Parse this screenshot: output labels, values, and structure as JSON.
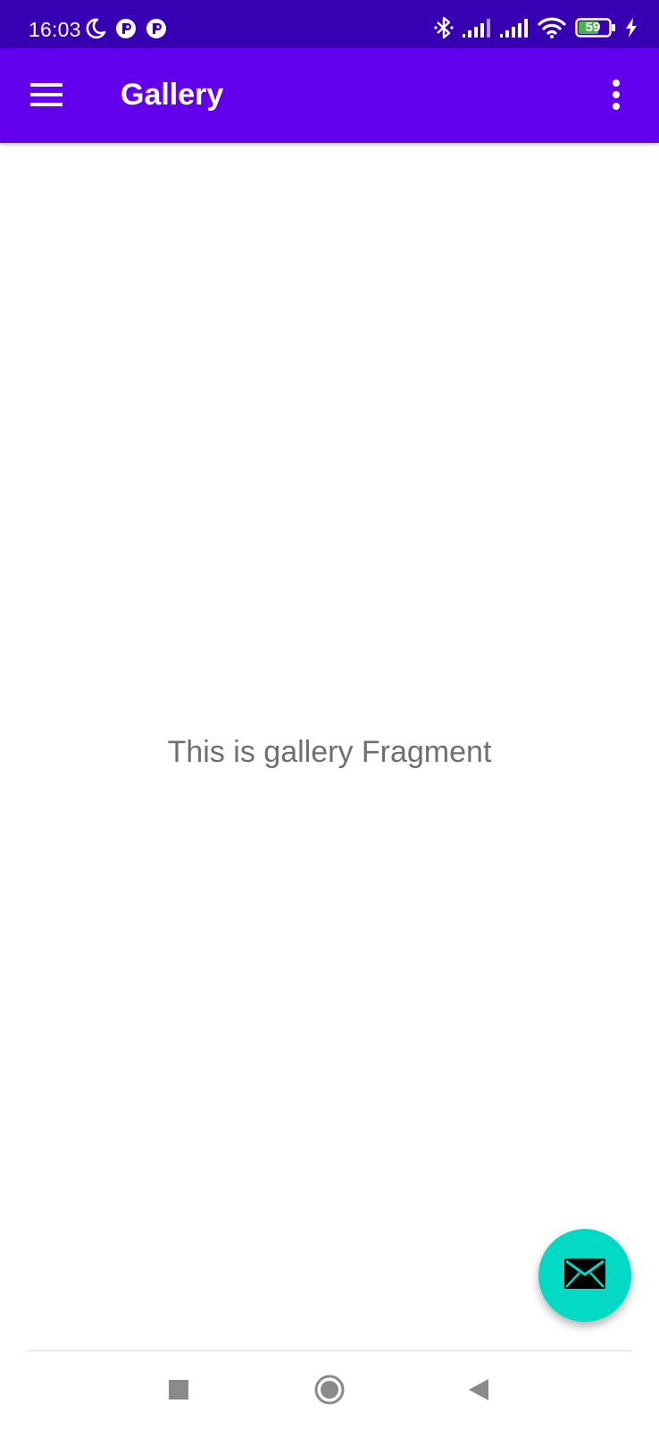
{
  "status_bar": {
    "time": "16:03",
    "battery_level": "59",
    "background_color": "#3700b3",
    "left_icons": [
      "moon-icon",
      "notification-app-icon",
      "notification-app-icon"
    ],
    "right_icons": [
      "bluetooth-icon",
      "signal-icon",
      "signal-icon",
      "wifi-icon",
      "battery-icon",
      "charging-icon"
    ]
  },
  "app_bar": {
    "title": "Gallery",
    "background_color": "#6200ee",
    "navigation_icon": "hamburger-menu-icon",
    "overflow_icon": "more-vertical-icon"
  },
  "content": {
    "message": "This is gallery Fragment"
  },
  "fab": {
    "icon": "mail-icon",
    "color": "#03dac5"
  },
  "nav_bar": {
    "buttons": [
      "recents-icon",
      "home-icon",
      "back-icon"
    ]
  }
}
